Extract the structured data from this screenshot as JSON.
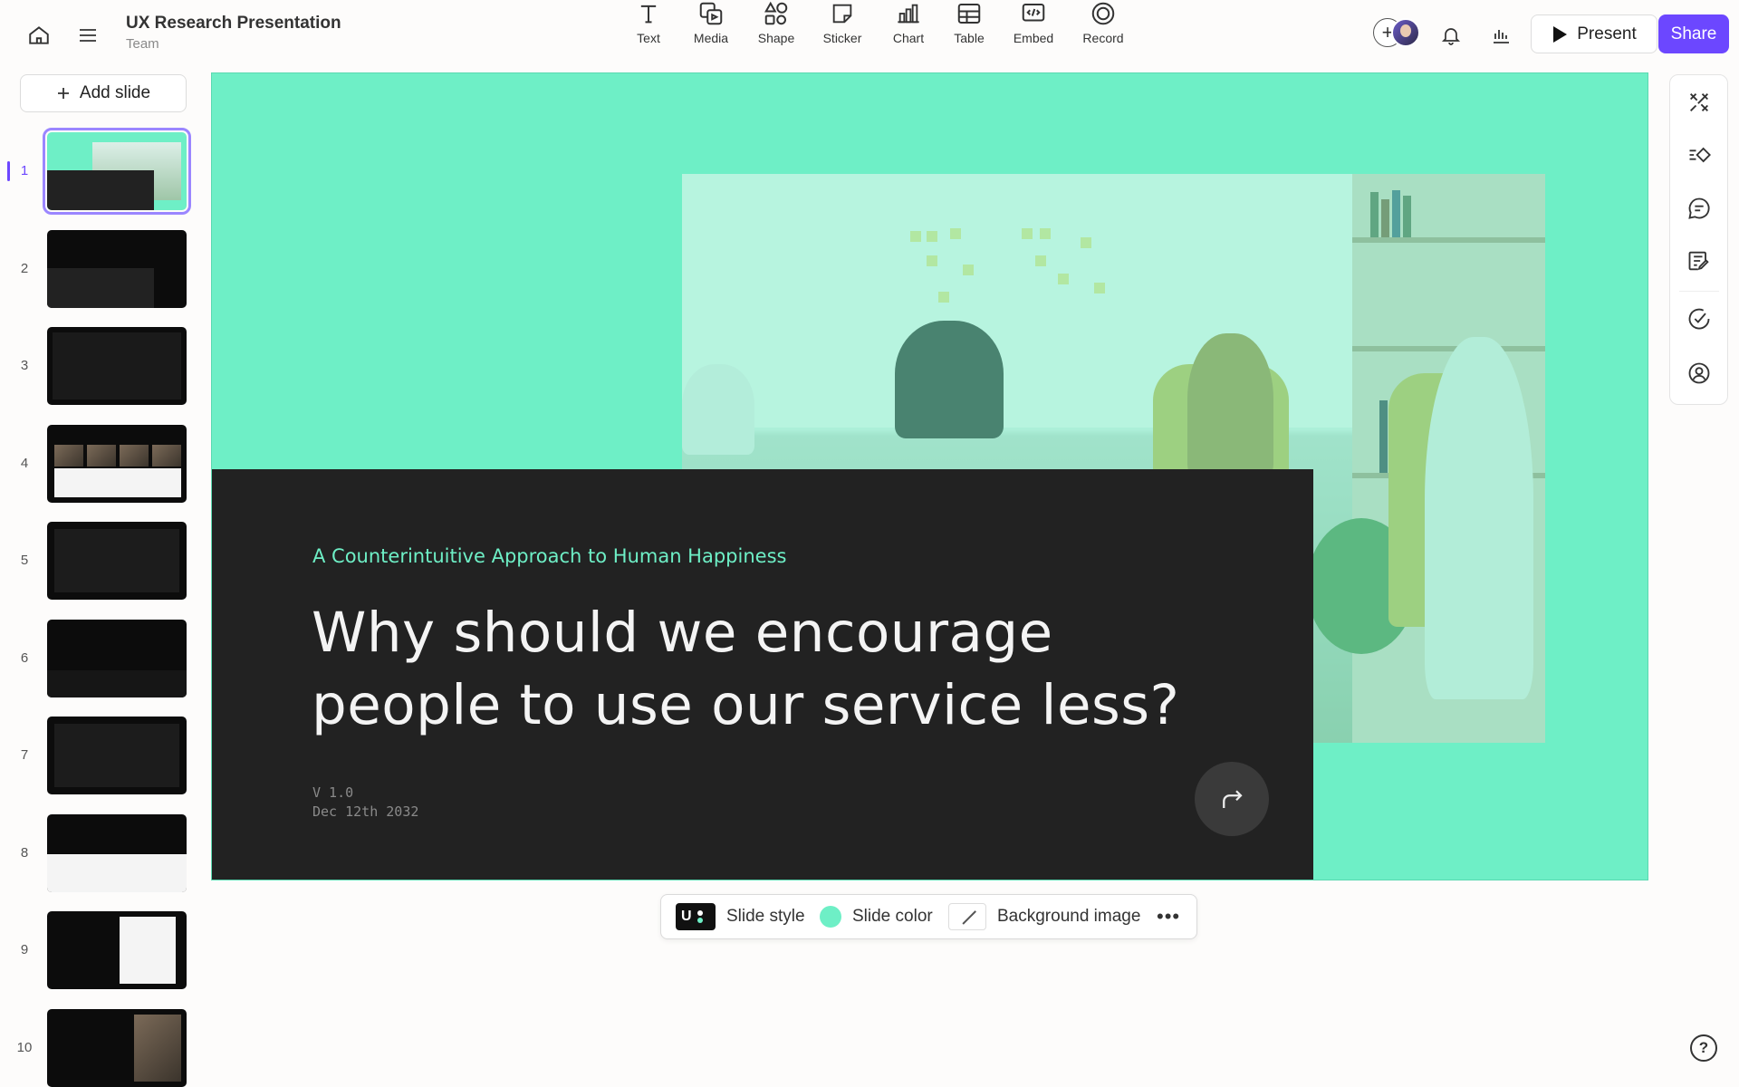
{
  "header": {
    "title": "UX Research Presentation",
    "subtitle": "Team",
    "present_label": "Present",
    "share_label": "Share",
    "add_collaborator": "+"
  },
  "tools": [
    {
      "label": "Text",
      "icon": "text-icon"
    },
    {
      "label": "Media",
      "icon": "media-icon"
    },
    {
      "label": "Shape",
      "icon": "shape-icon"
    },
    {
      "label": "Sticker",
      "icon": "sticker-icon"
    },
    {
      "label": "Chart",
      "icon": "chart-icon"
    },
    {
      "label": "Table",
      "icon": "table-icon"
    },
    {
      "label": "Embed",
      "icon": "embed-icon"
    },
    {
      "label": "Record",
      "icon": "record-icon"
    }
  ],
  "sidebar": {
    "add_slide_label": "Add slide",
    "active_index": 1,
    "slide_numbers": [
      "1",
      "2",
      "3",
      "4",
      "5",
      "6",
      "7",
      "8",
      "9",
      "10"
    ]
  },
  "slide": {
    "subtitle": "A Counterintuitive Approach to Human Happiness",
    "title": "Why should we encourage people to use our service less?",
    "version": "V 1.0",
    "date": "Dec 12th 2032"
  },
  "slide_toolbar": {
    "style_label": "Slide style",
    "color_label": "Slide color",
    "background_label": "Background image",
    "more_label": "•••"
  },
  "help_label": "?",
  "colors": {
    "accent": "#6c47ff",
    "slide_background": "#6eefc6",
    "slide_panel": "#222222"
  }
}
